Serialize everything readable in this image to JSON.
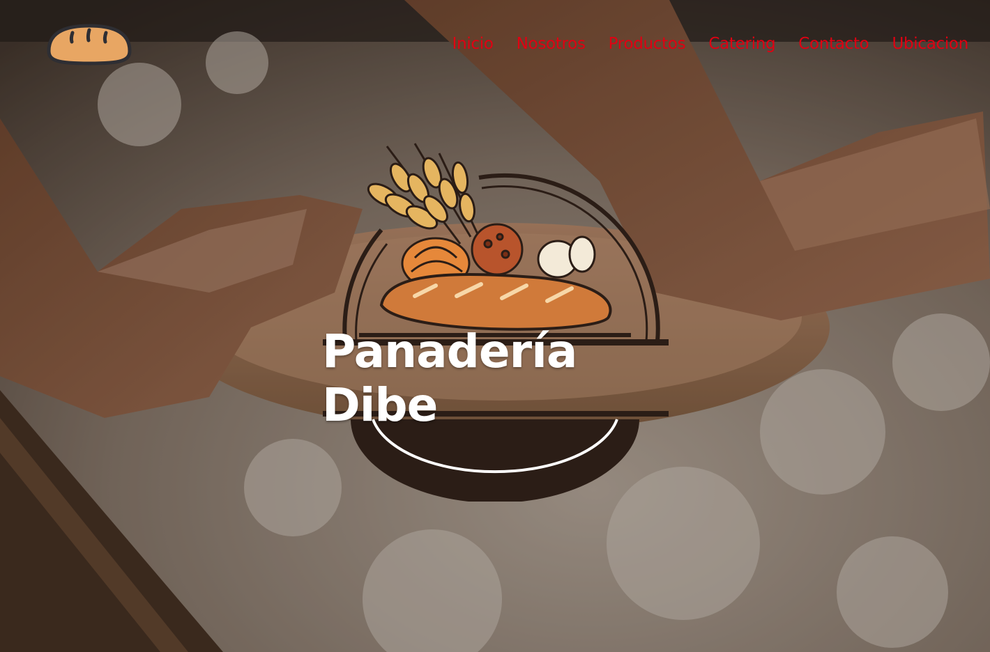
{
  "nav": {
    "logo_icon": "bread-loaf-icon",
    "links": [
      {
        "label": "Inicio"
      },
      {
        "label": "Nosotros"
      },
      {
        "label": "Productos"
      },
      {
        "label": "Catering"
      },
      {
        "label": "Contacto"
      },
      {
        "label": "Ubicacion"
      }
    ]
  },
  "hero": {
    "background": "hands-kneading-dough-on-floured-table",
    "emblem": {
      "icon": "bakery-emblem-icon",
      "title": "Panadería Dibe"
    }
  },
  "colors": {
    "nav_link": "#e00012",
    "emblem_dark": "#2b1d16",
    "bread": "#d07a3a",
    "wheat": "#e5b560",
    "title": "#ffffff"
  }
}
